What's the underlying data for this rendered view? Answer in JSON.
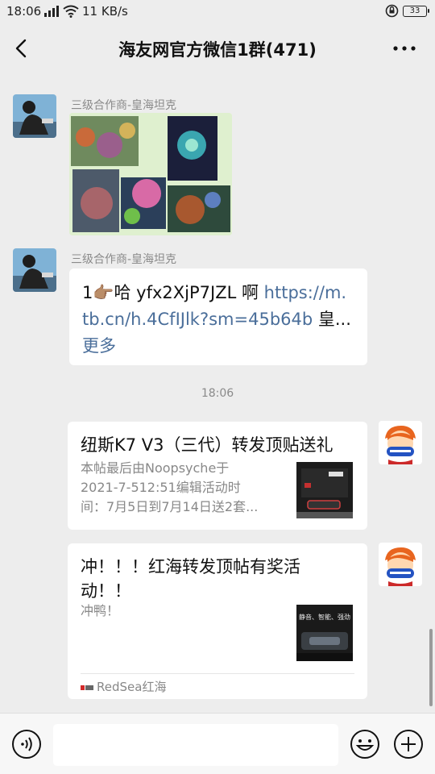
{
  "status_bar": {
    "time": "18:06",
    "net_speed": "11 KB/s",
    "battery": "33"
  },
  "header": {
    "title": "海友网官方微信1群(471)"
  },
  "messages": {
    "m1": {
      "sender": "三级合作商-皇海坦克"
    },
    "m2": {
      "sender": "三级合作商-皇海坦克",
      "line1_prefix": "1👉🏽哈 yfx2XjP7JZL 啊 ",
      "line1_link": "https://m.",
      "line2_link": "tb.cn/h.4CfIJlk?sm=45b64b",
      "line2_suffix": " 皇...",
      "more": "更多"
    },
    "time_separator": "18:06",
    "m3": {
      "title": "纽斯K7 V3（三代）转发顶贴送礼",
      "desc_lines": [
        "本帖最后由Noopsyche于",
        "2021-7-512:51编辑活动时",
        "间：7月5日到7月14日送2套..."
      ]
    },
    "m4": {
      "title_line1": "冲！！！红海转发顶帖有奖活",
      "title_line2": "动！！",
      "desc": "冲鸭！",
      "thumb_text": "静音、智能、强劲",
      "source": "RedSea红海"
    }
  },
  "colors": {
    "background": "#ededed",
    "bubble": "#ffffff",
    "link": "#4a6e9a",
    "meta_text": "#8a8a8a"
  },
  "icons": [
    "back-arrow",
    "more-dots",
    "voice",
    "emoji",
    "plus"
  ]
}
